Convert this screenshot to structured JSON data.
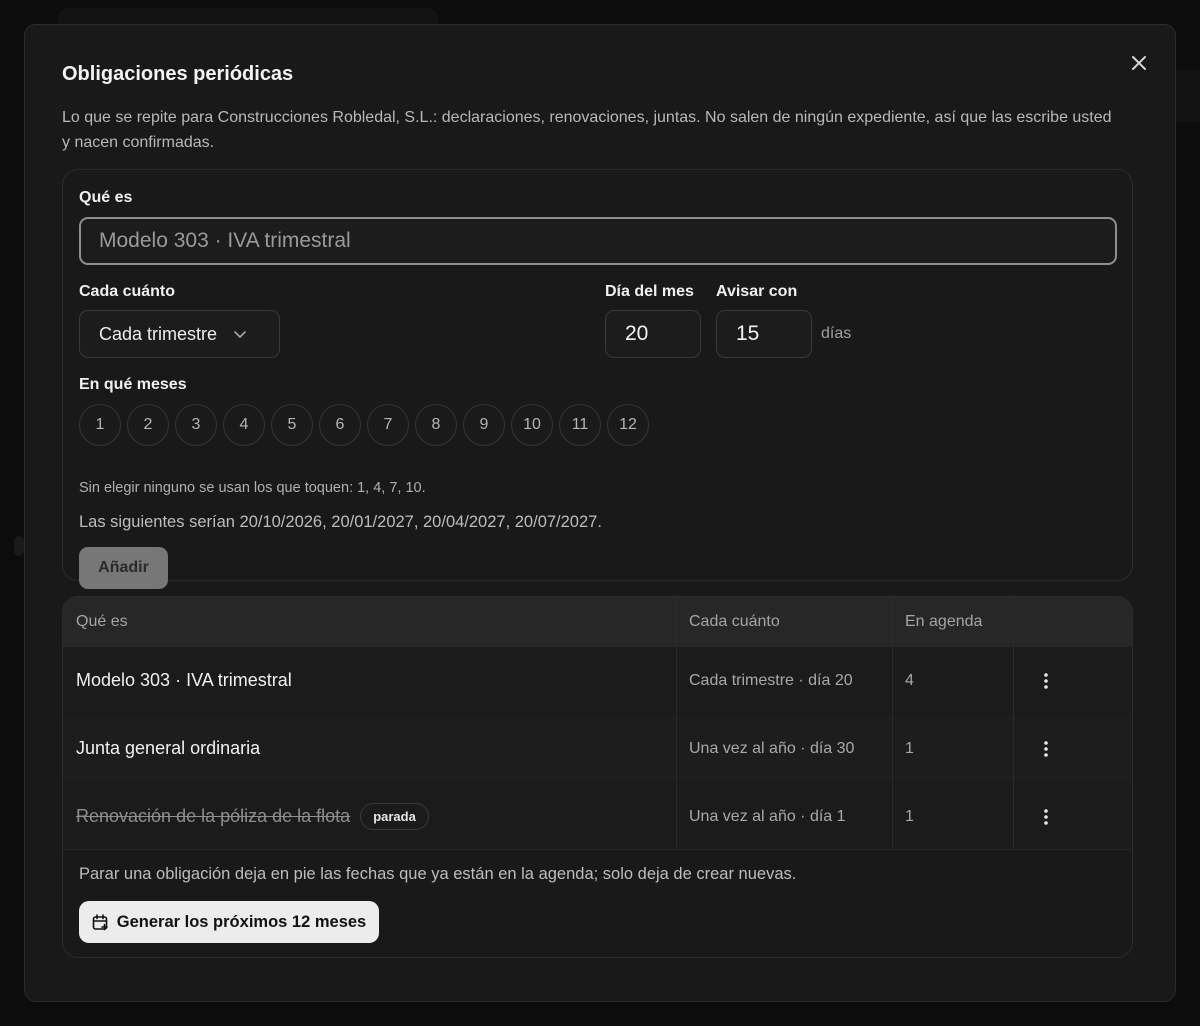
{
  "dialog": {
    "title": "Obligaciones periódicas",
    "description": "Lo que se repite para Construcciones Robledal, S.L.: declaraciones, renovaciones, juntas. No salen de ningún expediente, así que las escribe usted y nacen confirmadas.",
    "close_icon": "close-icon"
  },
  "form": {
    "what_label": "Qué es",
    "what_placeholder": "Modelo 303 · IVA trimestral",
    "frequency_label": "Cada cuánto",
    "frequency_value": "Cada trimestre",
    "day_label": "Día del mes",
    "day_value": "20",
    "notify_label": "Avisar con",
    "notify_value": "15",
    "notify_unit": "días",
    "months_label": "En qué meses",
    "months": [
      "1",
      "2",
      "3",
      "4",
      "5",
      "6",
      "7",
      "8",
      "9",
      "10",
      "11",
      "12"
    ],
    "hint": "Sin elegir ninguno se usan los que toquen: 1, 4, 7, 10.",
    "next_dates": "Las siguientes serían 20/10/2026, 20/01/2027, 20/04/2027, 20/07/2027.",
    "add_label": "Añadir"
  },
  "table": {
    "headers": [
      "Qué es",
      "Cada cuánto",
      "En agenda",
      ""
    ],
    "rows": [
      {
        "what": "Modelo 303 · IVA trimestral",
        "freq": "Cada trimestre · día 20",
        "count": "4",
        "stopped": false
      },
      {
        "what": "Junta general ordinaria",
        "freq": "Una vez al año · día 30",
        "count": "1",
        "stopped": false
      },
      {
        "what": "Renovación de la póliza de la flota",
        "freq": "Una vez al año · día 1",
        "count": "1",
        "stopped": true,
        "badge": "parada"
      }
    ],
    "footer_note": "Parar una obligación deja en pie las fechas que ya están en la agenda; solo deja de crear nuevas.",
    "generate_label": "Generar los próximos 12 meses",
    "generate_icon": "calendar-plus-icon",
    "row_menu_icon": "more-vertical-icon"
  }
}
